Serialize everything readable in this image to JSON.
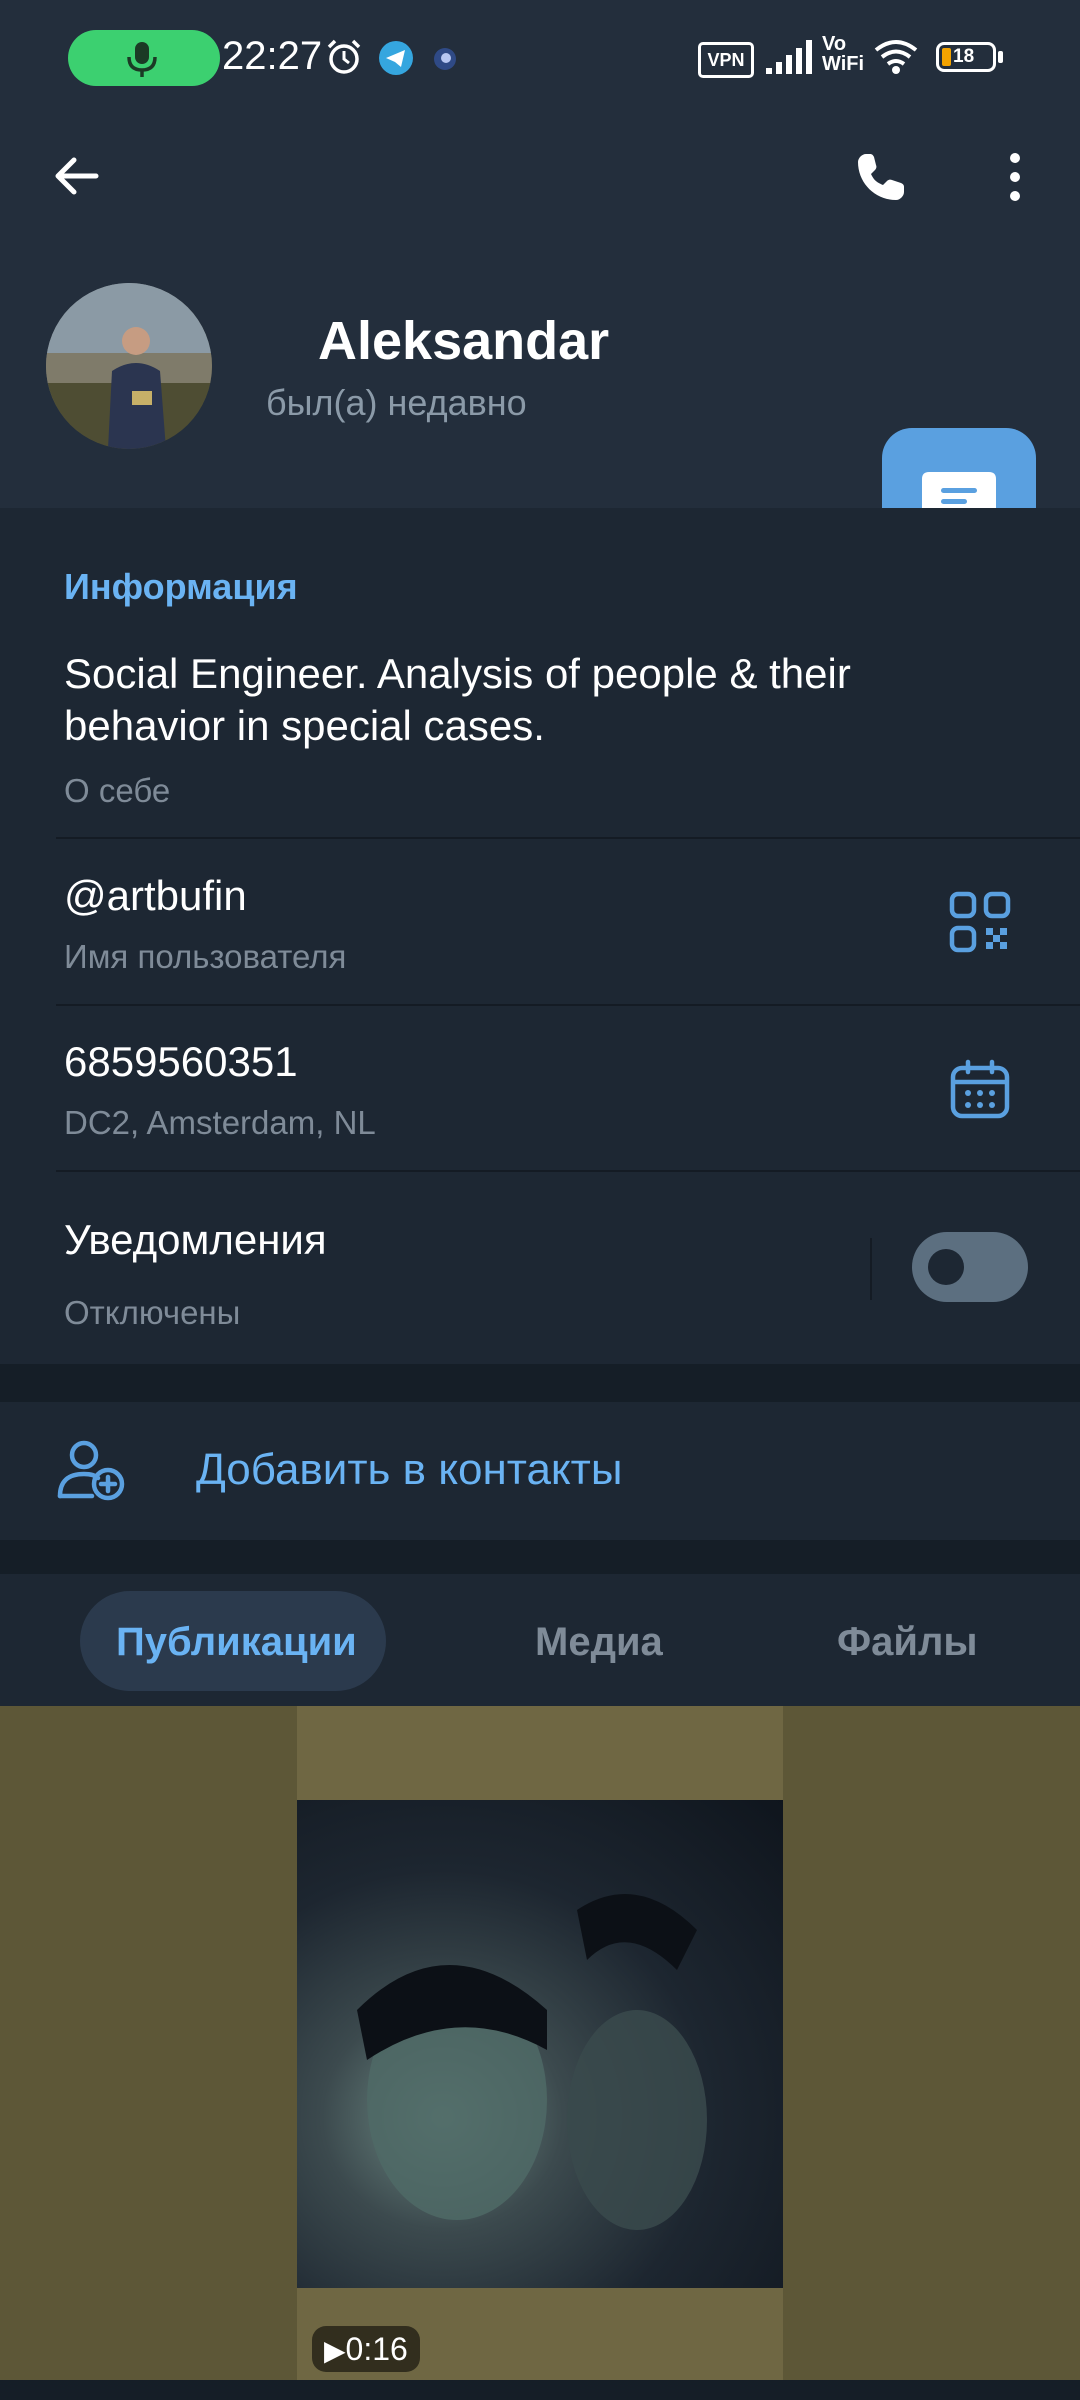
{
  "status_bar": {
    "time": "22:27",
    "vpn_label": "VPN",
    "vowifi_label_top": "Vo",
    "vowifi_label_bottom": "WiFi",
    "battery_level": "18"
  },
  "header": {
    "name": "Aleksandar",
    "last_seen": "был(а) недавно"
  },
  "info": {
    "section_title": "Информация",
    "bio_line1": "Social Engineer. Analysis of people & their",
    "bio_line2": "behavior in special cases.",
    "bio_caption": "О себе",
    "username": "@artbufin",
    "username_caption": "Имя пользователя",
    "user_id": "6859560351",
    "user_id_caption": "DC2, Amsterdam, NL",
    "notifications_label": "Уведомления",
    "notifications_status": "Отключены",
    "notifications_enabled": false
  },
  "add_contact": {
    "label": "Добавить в контакты"
  },
  "tabs": [
    {
      "label": "Публикации",
      "active": true
    },
    {
      "label": "Медиа",
      "active": false
    },
    {
      "label": "Файлы",
      "active": false
    }
  ],
  "media": {
    "duration": "0:16"
  },
  "colors": {
    "accent": "#6ab3f3",
    "header_bg": "#232e3c",
    "body_bg": "#1d2733",
    "fab": "#5aa0e0",
    "mic_pill": "#3cd070"
  }
}
